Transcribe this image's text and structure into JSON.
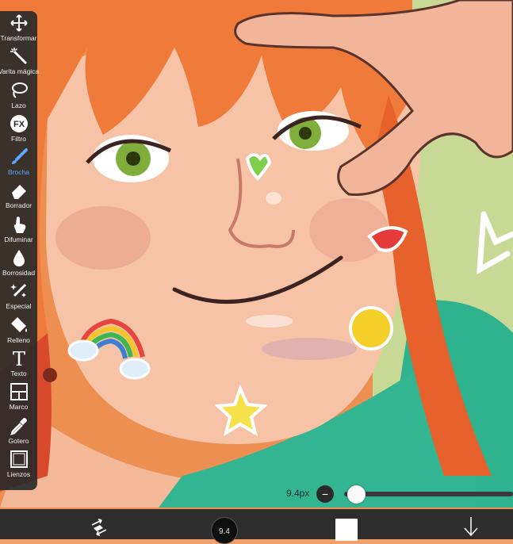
{
  "toolbar": {
    "tools": [
      {
        "label": "Transformar",
        "icon": "move-arrows-icon"
      },
      {
        "label": "Varita mágica",
        "icon": "magic-wand-icon"
      },
      {
        "label": "Lazo",
        "icon": "lasso-icon"
      },
      {
        "label": "Filtro",
        "icon": "fx-icon"
      },
      {
        "label": "Brocha",
        "icon": "brush-icon",
        "active": true
      },
      {
        "label": "Borrador",
        "icon": "eraser-icon"
      },
      {
        "label": "Difuminar",
        "icon": "smudge-finger-icon"
      },
      {
        "label": "Borrosidad",
        "icon": "blur-drop-icon"
      },
      {
        "label": "Especial",
        "icon": "special-brush-icon"
      },
      {
        "label": "Relleno",
        "icon": "fill-bucket-icon"
      },
      {
        "label": "Texto",
        "icon": "text-T-icon"
      },
      {
        "label": "Marco",
        "icon": "frame-divider-icon"
      },
      {
        "label": "Gotero",
        "icon": "eyedropper-icon"
      },
      {
        "label": "Lienzos",
        "icon": "canvas-icon"
      }
    ],
    "active_color": "#5aa9ff"
  },
  "brush": {
    "size_label": "9.4px",
    "minus_symbol": "−",
    "cursor_value": "9.4",
    "size_fraction": 0.03
  },
  "bottom_bar": {
    "undo_icon": "swap-arrows-icon",
    "color_swatch": "#ffffff",
    "download_icon": "arrow-down-icon"
  },
  "colors": {
    "hair": "#f07a3a",
    "skin": "#f2b79a",
    "shirt": "#2fb28e",
    "background_green": "#c5d89a"
  }
}
